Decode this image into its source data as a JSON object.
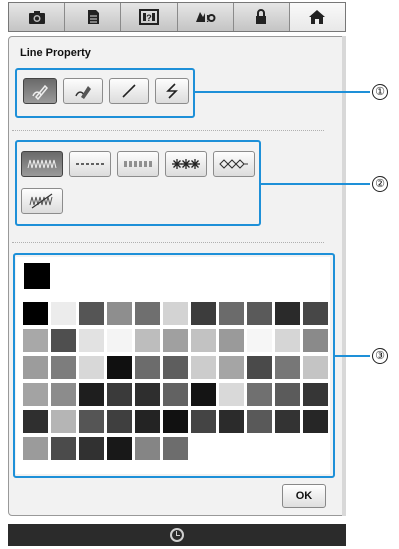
{
  "tabs": [
    {
      "icon": "camera-icon"
    },
    {
      "icon": "document-icon"
    },
    {
      "icon": "help-icon"
    },
    {
      "icon": "settings-icon"
    },
    {
      "icon": "lock-icon"
    },
    {
      "icon": "home-icon"
    }
  ],
  "panel": {
    "title": "Line Property"
  },
  "line_tools": [
    {
      "icon": "line-pen-icon",
      "selected": true
    },
    {
      "icon": "line-eraser-icon",
      "selected": false
    },
    {
      "icon": "straight-line-icon",
      "selected": false
    },
    {
      "icon": "zigzag-line-icon",
      "selected": false
    }
  ],
  "line_types": [
    {
      "icon": "zigzag-stitch-icon",
      "selected": true
    },
    {
      "icon": "running-stitch-icon",
      "selected": false
    },
    {
      "icon": "triple-stitch-icon",
      "selected": false
    },
    {
      "icon": "candlewicking-stitch-icon",
      "selected": false
    },
    {
      "icon": "chain-stitch-icon",
      "selected": false
    },
    {
      "icon": "no-sew-line-icon",
      "selected": false
    }
  ],
  "current_color": "#000000",
  "palette": [
    "#000000",
    "#ececec",
    "#555555",
    "#8e8e8e",
    "#6f6f6f",
    "#d3d3d3",
    "#3c3c3c",
    "#6b6b6b",
    "#5a5a5a",
    "#2a2a2a",
    "#474747",
    "#a8a8a8",
    "#4f4f4f",
    "#e2e2e2",
    "#f4f4f4",
    "#bdbdbd",
    "#a0a0a0",
    "#c2c2c2",
    "#9a9a9a",
    "#f6f6f6",
    "#d6d6d6",
    "#8a8a8a",
    "#9c9c9c",
    "#7d7d7d",
    "#d8d8d8",
    "#101010",
    "#6c6c6c",
    "#5e5e5e",
    "#cccccc",
    "#a5a5a5",
    "#4a4a4a",
    "#777777",
    "#c4c4c4",
    "#a3a3a3",
    "#8c8c8c",
    "#1e1e1e",
    "#3a3a3a",
    "#2e2e2e",
    "#626262",
    "#141414",
    "#d9d9d9",
    "#707070",
    "#5b5b5b",
    "#363636",
    "#2f2f2f",
    "#b5b5b5",
    "#555555",
    "#3f3f3f",
    "#232323",
    "#111111",
    "#444444",
    "#2b2b2b",
    "#595959",
    "#333333",
    "#262626",
    "#9b9b9b",
    "#4b4b4b",
    "#313131",
    "#181818",
    "#858585",
    "#6d6d6d"
  ],
  "callouts": [
    "①",
    "②",
    "③"
  ],
  "ok_label": "OK"
}
